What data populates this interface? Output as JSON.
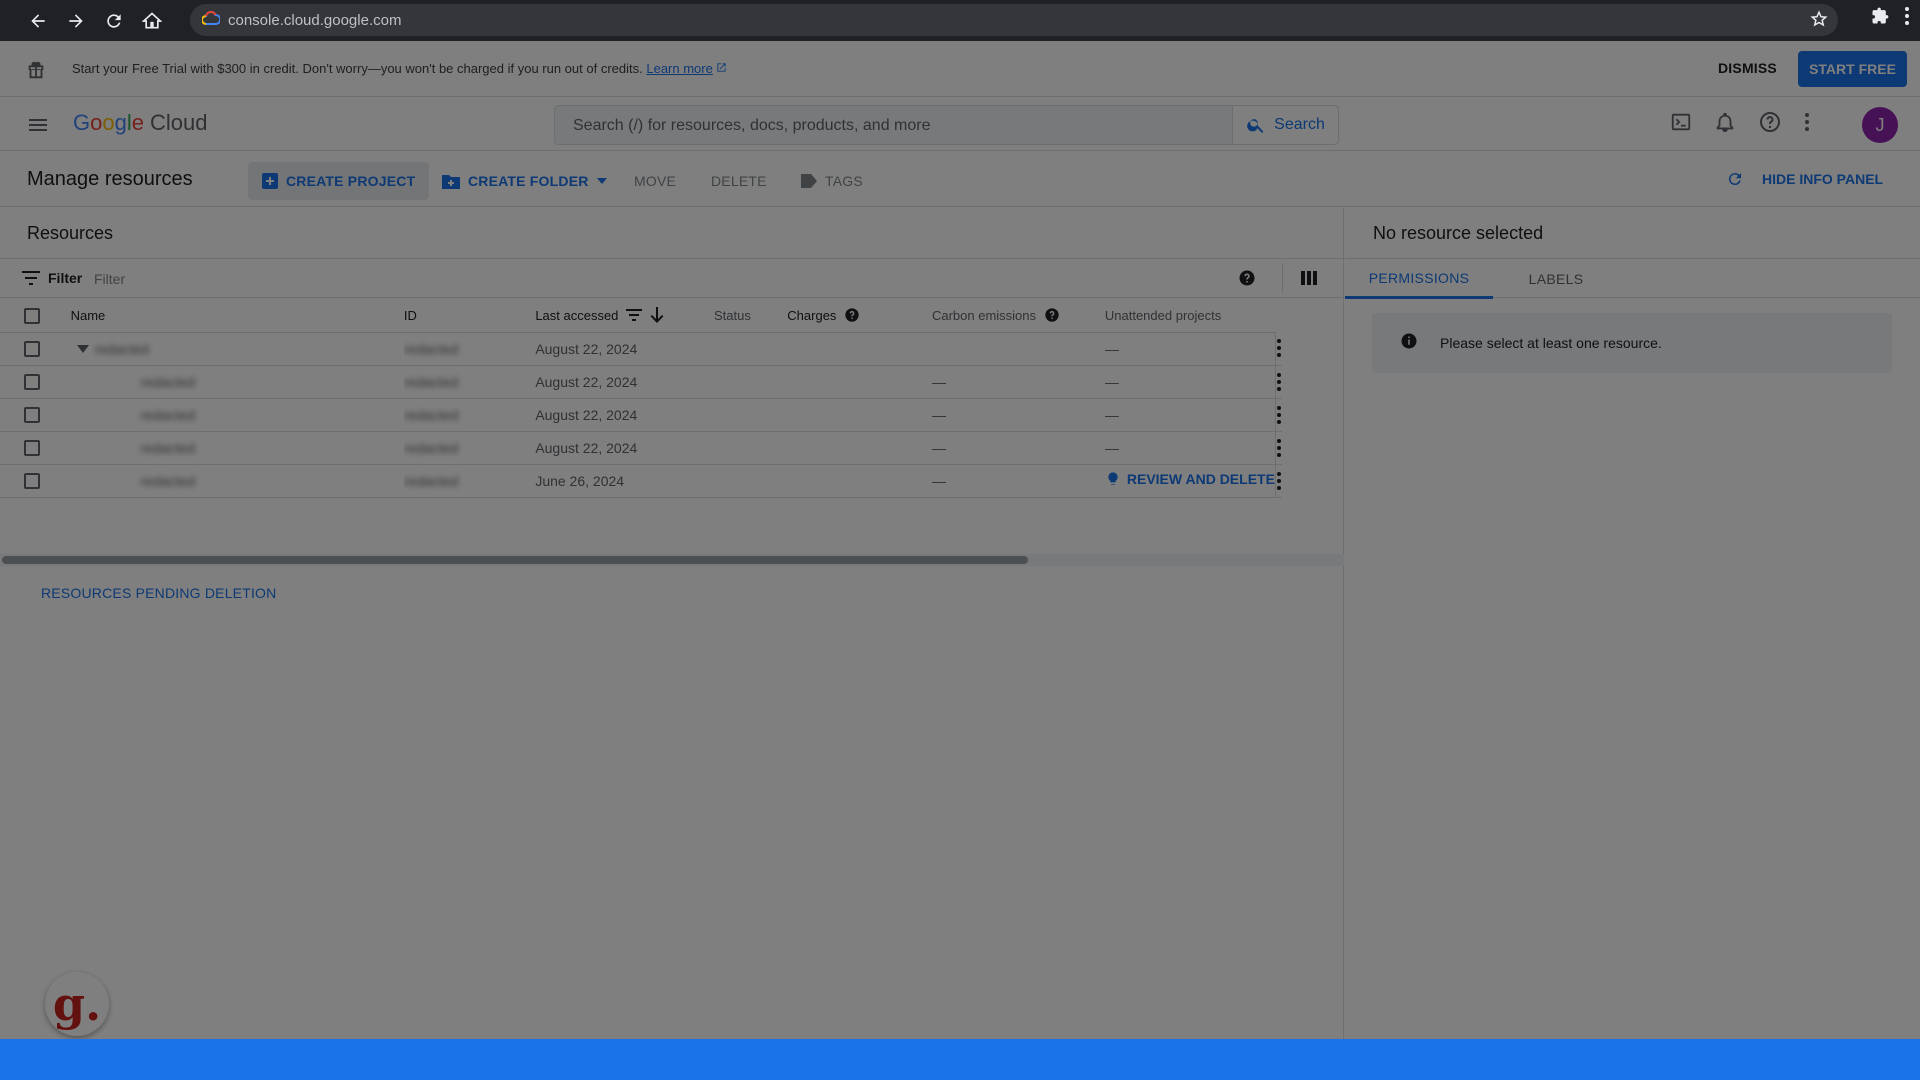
{
  "browser": {
    "url": "console.cloud.google.com"
  },
  "banner": {
    "message": "Start your Free Trial with $300 in credit. Don't worry—you won't be charged if you run out of credits.",
    "learn_more": "Learn more",
    "dismiss": "DISMISS",
    "start_free": "START FREE"
  },
  "header": {
    "logo_letters": [
      "G",
      "o",
      "o",
      "g",
      "l",
      "e"
    ],
    "logo_product": "Cloud",
    "search_placeholder": "Search (/) for resources, docs, products, and more",
    "search_button": "Search",
    "avatar_initial": "J"
  },
  "toolbar": {
    "title": "Manage resources",
    "create_project": "CREATE PROJECT",
    "create_folder": "CREATE FOLDER",
    "move": "MOVE",
    "delete": "DELETE",
    "tags": "TAGS",
    "hide_info_panel": "HIDE INFO PANEL"
  },
  "resources": {
    "title": "Resources",
    "filter_label": "Filter",
    "filter_placeholder": "Filter",
    "columns": {
      "name": "Name",
      "id": "ID",
      "last_accessed": "Last accessed",
      "status": "Status",
      "charges": "Charges",
      "carbon": "Carbon emissions",
      "unattended": "Unattended projects"
    },
    "rows": [
      {
        "name": "redacted",
        "id": "redacted",
        "last_accessed": "August 22, 2024",
        "carbon": "",
        "unattended": "—"
      },
      {
        "name": "redacted",
        "id": "redacted",
        "last_accessed": "August 22, 2024",
        "carbon": "—",
        "unattended": "—"
      },
      {
        "name": "redacted",
        "id": "redacted",
        "last_accessed": "August 22, 2024",
        "carbon": "—",
        "unattended": "—"
      },
      {
        "name": "redacted",
        "id": "redacted",
        "last_accessed": "August 22, 2024",
        "carbon": "—",
        "unattended": "—"
      },
      {
        "name": "redacted",
        "id": "redacted",
        "last_accessed": "June 26, 2024",
        "carbon": "—",
        "unattended": "REVIEW AND DELETE"
      }
    ],
    "pending_deletion": "RESOURCES PENDING DELETION"
  },
  "info_panel": {
    "title": "No resource selected",
    "tabs": [
      "PERMISSIONS",
      "LABELS"
    ],
    "active_tab": "PERMISSIONS",
    "message": "Please select at least one resource."
  },
  "badge": {
    "letter": "g."
  },
  "colors": {
    "accent": "#1a73e8",
    "taskbar": "#1a73e8",
    "avatar": "#8e24aa"
  }
}
